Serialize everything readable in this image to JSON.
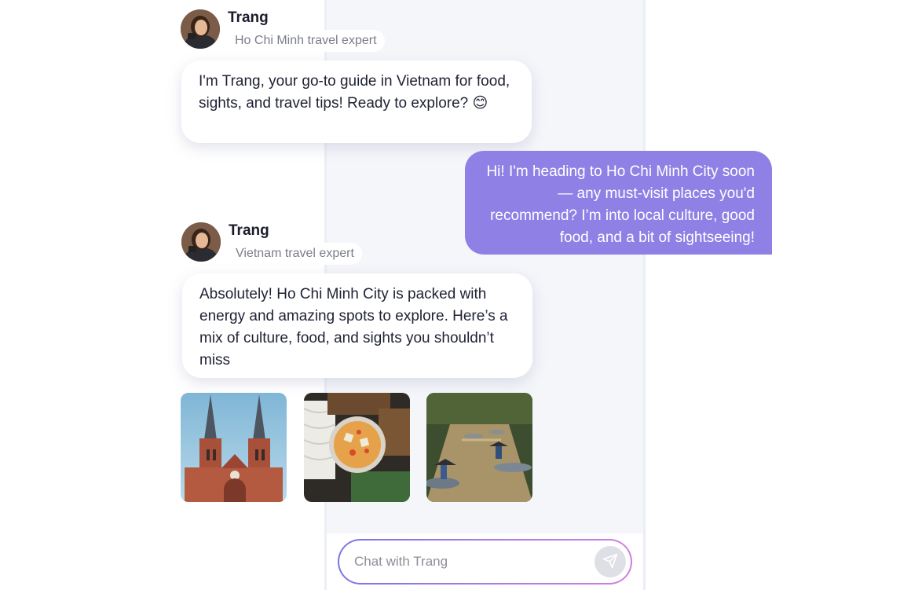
{
  "messages": [
    {
      "sender": "Trang",
      "role": "Ho Chi Minh travel expert",
      "text": "I'm Trang, your go-to guide in Vietnam for food, sights, and travel tips! Ready to explore? 😊"
    },
    {
      "sender": "user",
      "text": "Hi! I'm heading to Ho Chi Minh City soon — any must-visit places you'd recommend? I’m into local culture, good food, and a bit of sightseeing!"
    },
    {
      "sender": "Trang",
      "role": "Vietnam travel expert",
      "text": "Absolutely! Ho Chi Minh City is packed with energy and amazing spots to explore. Here’s a mix of culture, food, and sights you shouldn’t miss"
    }
  ],
  "photos": [
    {
      "subject": "cathedral-photo"
    },
    {
      "subject": "food-photo"
    },
    {
      "subject": "boats-photo"
    }
  ],
  "input": {
    "placeholder": "Chat with Trang",
    "value": ""
  },
  "icons": {
    "send": "send-icon"
  },
  "colors": {
    "user_bubble": "#8f80e6",
    "panel_bg": "#f5f6fa",
    "input_gradient_start": "#7b74e8",
    "input_gradient_end": "#cf7fe0"
  }
}
